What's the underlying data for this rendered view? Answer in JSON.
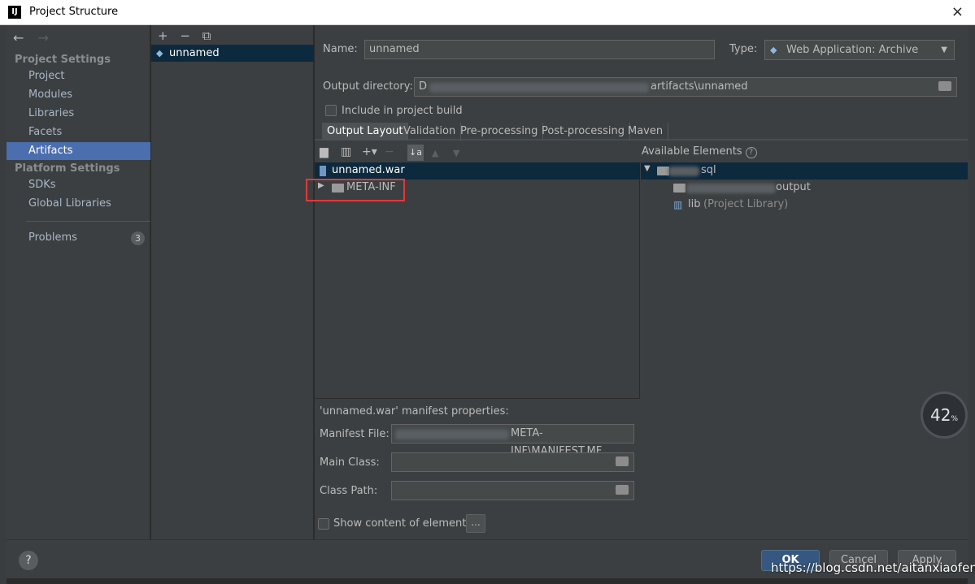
{
  "window": {
    "title": "Project Structure",
    "close": "×"
  },
  "nav": {
    "back": "←",
    "forward": "→"
  },
  "sidebar": {
    "project_settings_header": "Project Settings",
    "project_items": [
      "Project",
      "Modules",
      "Libraries",
      "Facets",
      "Artifacts"
    ],
    "selected": "Artifacts",
    "platform_settings_header": "Platform Settings",
    "platform_items": [
      "SDKs",
      "Global Libraries"
    ],
    "problems_label": "Problems",
    "problems_count": "3"
  },
  "artifacts": {
    "toolbar": {
      "add": "+",
      "remove": "−",
      "copy": "⧉"
    },
    "items": [
      "unnamed"
    ]
  },
  "form": {
    "name_label": "Name:",
    "name_value": "unnamed",
    "type_label": "Type:",
    "type_value": "Web Application: Archive",
    "output_dir_label": "Output directory:",
    "output_dir_prefix": "D",
    "output_dir_suffix": "artifacts\\unnamed",
    "include_build_label": "Include in project build",
    "include_build_checked": false
  },
  "tabs": [
    "Output Layout",
    "Validation",
    "Pre-processing",
    "Post-processing",
    "Maven"
  ],
  "active_tab": "Output Layout",
  "output_layout": {
    "root": "unnamed.war",
    "children": [
      "META-INF"
    ]
  },
  "available": {
    "header": "Available Elements",
    "help": "?",
    "root_suffix": "sql",
    "output_suffix": "output",
    "lib_name": "lib",
    "lib_note": "(Project Library)"
  },
  "manifest": {
    "header": "'unnamed.war' manifest properties:",
    "file_label": "Manifest File:",
    "file_suffix": "META-INF\\MANIFEST.MF",
    "main_class_label": "Main Class:",
    "main_class_value": "",
    "class_path_label": "Class Path:",
    "class_path_value": "",
    "show_content_label": "Show content of elements",
    "more_btn": "..."
  },
  "buttons": {
    "help": "?",
    "ok": "OK",
    "cancel": "Cancel",
    "apply": "Apply"
  },
  "overlay": {
    "gauge_value": "42",
    "gauge_unit": "%",
    "watermark": "https://blog.csdn.net/aitanxiaofeng"
  }
}
